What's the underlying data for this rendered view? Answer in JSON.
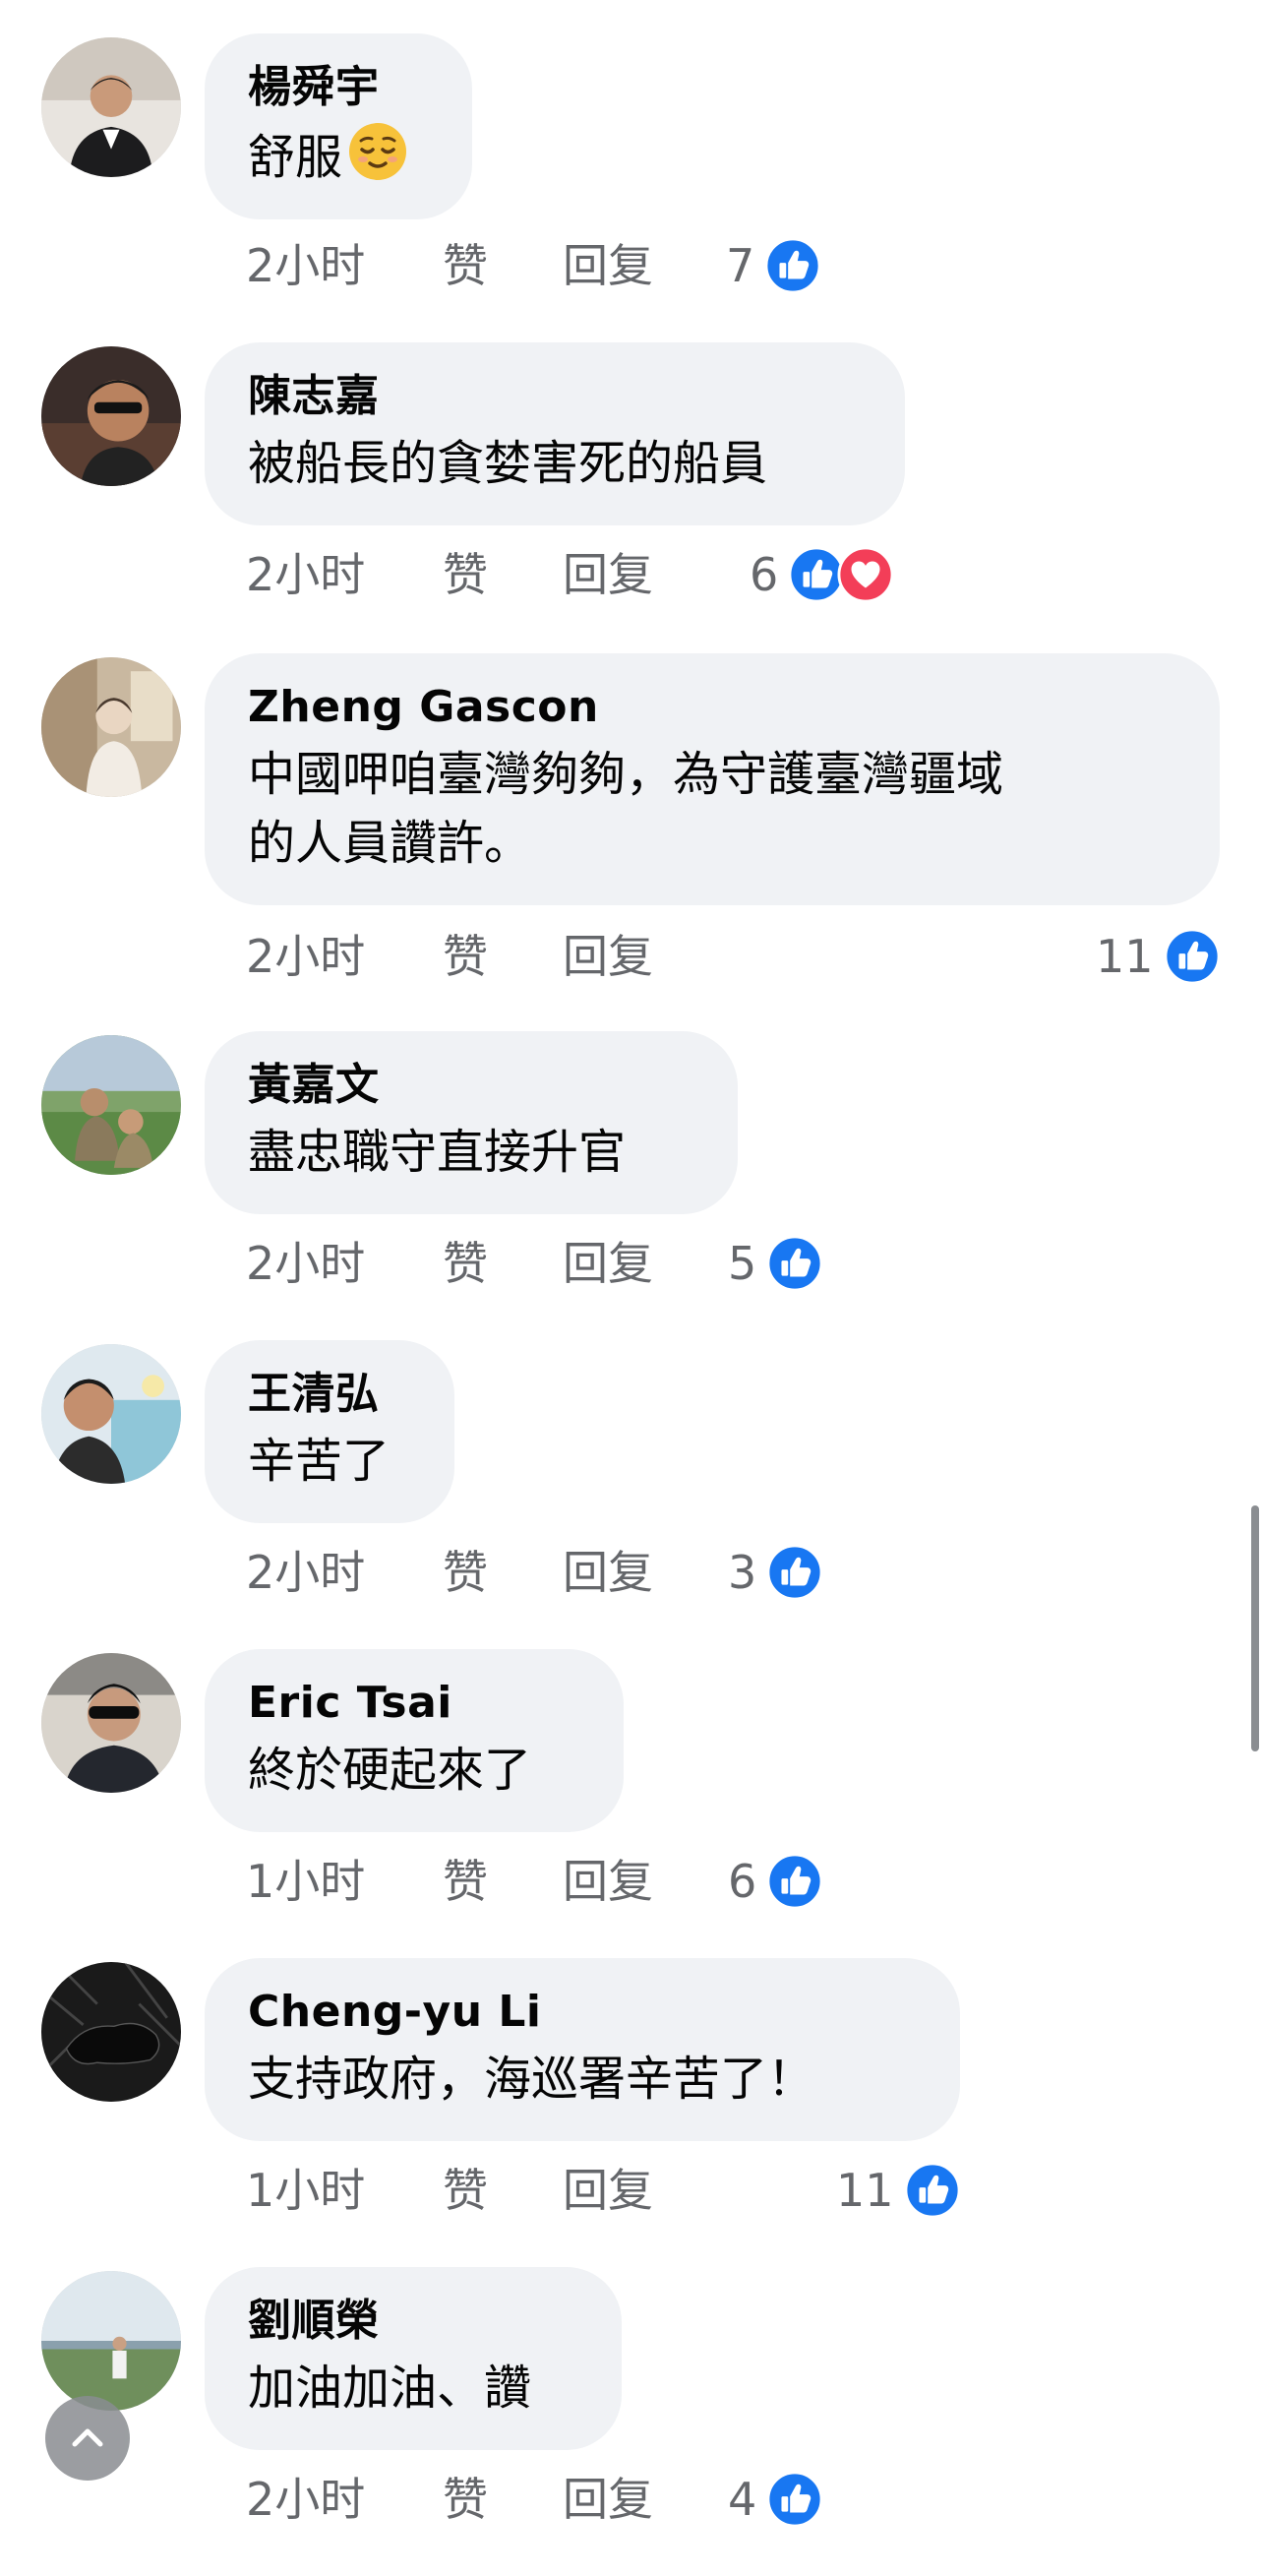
{
  "actions": {
    "like": "赞",
    "reply": "回复"
  },
  "colors": {
    "like_blue": "#1877f2",
    "love_red": "#f33e58",
    "bubble": "#f0f2f5",
    "meta_text": "#65676b"
  },
  "scroll_top_icon": "chevron-up-icon",
  "comments": [
    {
      "author": "楊舜宇",
      "text": "舒服",
      "emoji": "relieved-face",
      "time": "2小时",
      "reaction_count": "7",
      "reactions": [
        "like"
      ]
    },
    {
      "author": "陳志嘉",
      "text": "被船長的貪婪害死的船員",
      "time": "2小时",
      "reaction_count": "6",
      "reactions": [
        "like",
        "love"
      ]
    },
    {
      "author": "Zheng Gascon",
      "text": "中國呷咱臺灣夠夠，為守護臺灣疆域",
      "text2": "的人員讚許。",
      "time": "2小时",
      "reaction_count": "11",
      "reactions": [
        "like"
      ]
    },
    {
      "author": "黃嘉文",
      "text": "盡忠職守直接升官",
      "time": "2小时",
      "reaction_count": "5",
      "reactions": [
        "like"
      ]
    },
    {
      "author": "王清弘",
      "text": "辛苦了",
      "time": "2小时",
      "reaction_count": "3",
      "reactions": [
        "like"
      ]
    },
    {
      "author": "Eric Tsai",
      "text": "終於硬起來了",
      "time": "1小时",
      "reaction_count": "6",
      "reactions": [
        "like"
      ]
    },
    {
      "author": "Cheng-yu Li",
      "text": "支持政府，海巡署辛苦了！",
      "time": "1小时",
      "reaction_count": "11",
      "reactions": [
        "like"
      ]
    },
    {
      "author": "劉順榮",
      "text": "加油加油、讚",
      "time": "2小时",
      "reaction_count": "4",
      "reactions": [
        "like"
      ]
    }
  ]
}
